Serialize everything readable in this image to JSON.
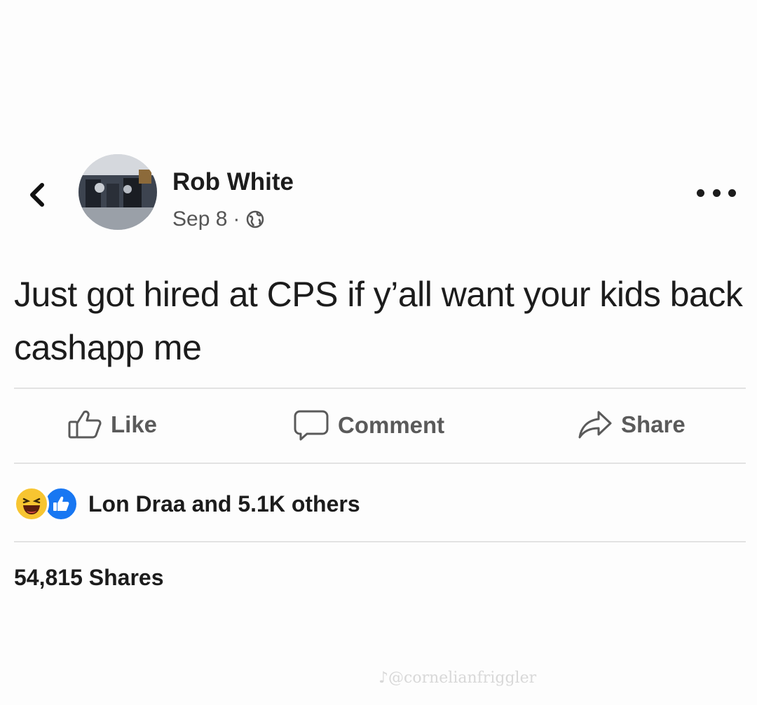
{
  "post": {
    "author_name": "Rob White",
    "date": "Sep 8",
    "separator": "·",
    "privacy_icon": "globe-icon",
    "text": "Just got hired at CPS if y’all want your kids back cashapp me"
  },
  "actions": {
    "like_label": "Like",
    "comment_label": "Comment",
    "share_label": "Share"
  },
  "reactions": {
    "icons": [
      "haha-reaction-icon",
      "like-reaction-icon"
    ],
    "summary": "Lon Draa and 5.1K others"
  },
  "shares": {
    "count_text": "54,815 Shares"
  },
  "watermark": {
    "text": "♪@cornelianfriggler"
  },
  "colors": {
    "like_blue": "#1877f2",
    "haha_yellow": "#f7c531",
    "text_dark": "#1c1c1c",
    "action_gray": "#5a5a5a"
  }
}
